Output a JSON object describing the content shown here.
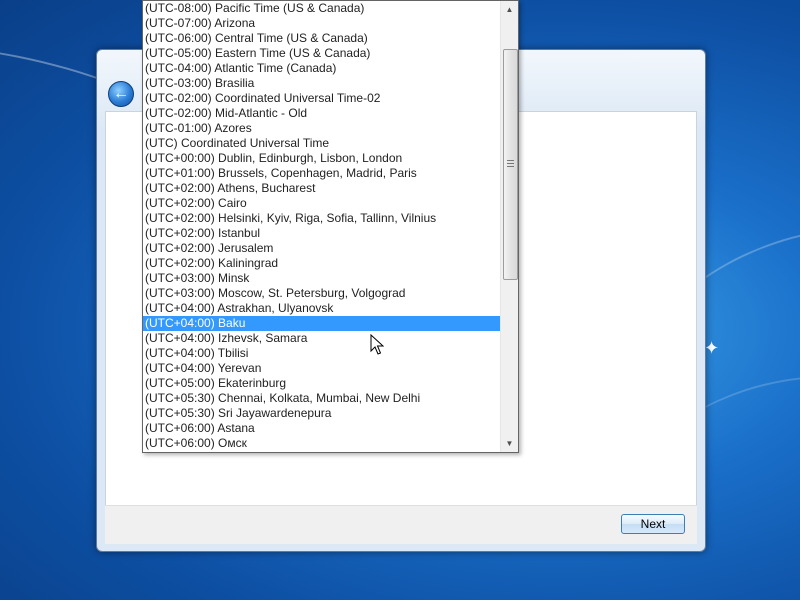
{
  "timezone_list": {
    "items": [
      "(UTC-08:00) Pacific Time (US & Canada)",
      "(UTC-07:00) Arizona",
      "(UTC-06:00) Central Time (US & Canada)",
      "(UTC-05:00) Eastern Time (US & Canada)",
      "(UTC-04:00) Atlantic Time (Canada)",
      "(UTC-03:00) Brasilia",
      "(UTC-02:00) Coordinated Universal Time-02",
      "(UTC-02:00) Mid-Atlantic - Old",
      "(UTC-01:00) Azores",
      "(UTC) Coordinated Universal Time",
      "(UTC+00:00) Dublin, Edinburgh, Lisbon, London",
      "(UTC+01:00) Brussels, Copenhagen, Madrid, Paris",
      "(UTC+02:00) Athens, Bucharest",
      "(UTC+02:00) Cairo",
      "(UTC+02:00) Helsinki, Kyiv, Riga, Sofia, Tallinn, Vilnius",
      "(UTC+02:00) Istanbul",
      "(UTC+02:00) Jerusalem",
      "(UTC+02:00) Kaliningrad",
      "(UTC+03:00) Minsk",
      "(UTC+03:00) Moscow, St. Petersburg, Volgograd",
      "(UTC+04:00) Astrakhan, Ulyanovsk",
      "(UTC+04:00) Baku",
      "(UTC+04:00) Izhevsk, Samara",
      "(UTC+04:00) Tbilisi",
      "(UTC+04:00) Yerevan",
      "(UTC+05:00) Ekaterinburg",
      "(UTC+05:30) Chennai, Kolkata, Mumbai, New Delhi",
      "(UTC+05:30) Sri Jayawardenepura",
      "(UTC+06:00) Astana",
      "(UTC+06:00) Омск"
    ],
    "selected_index": 21
  },
  "footer": {
    "next_label": "Next"
  },
  "icons": {
    "back": "back-arrow-icon",
    "scroll_up": "scroll-up-arrow-icon",
    "scroll_down": "scroll-down-arrow-icon",
    "cursor": "mouse-cursor-icon"
  },
  "colors": {
    "selection": "#3399ff",
    "desktop": "#1a6fc9",
    "next_border": "#3c7fb1"
  },
  "scroll_position": 0.12
}
